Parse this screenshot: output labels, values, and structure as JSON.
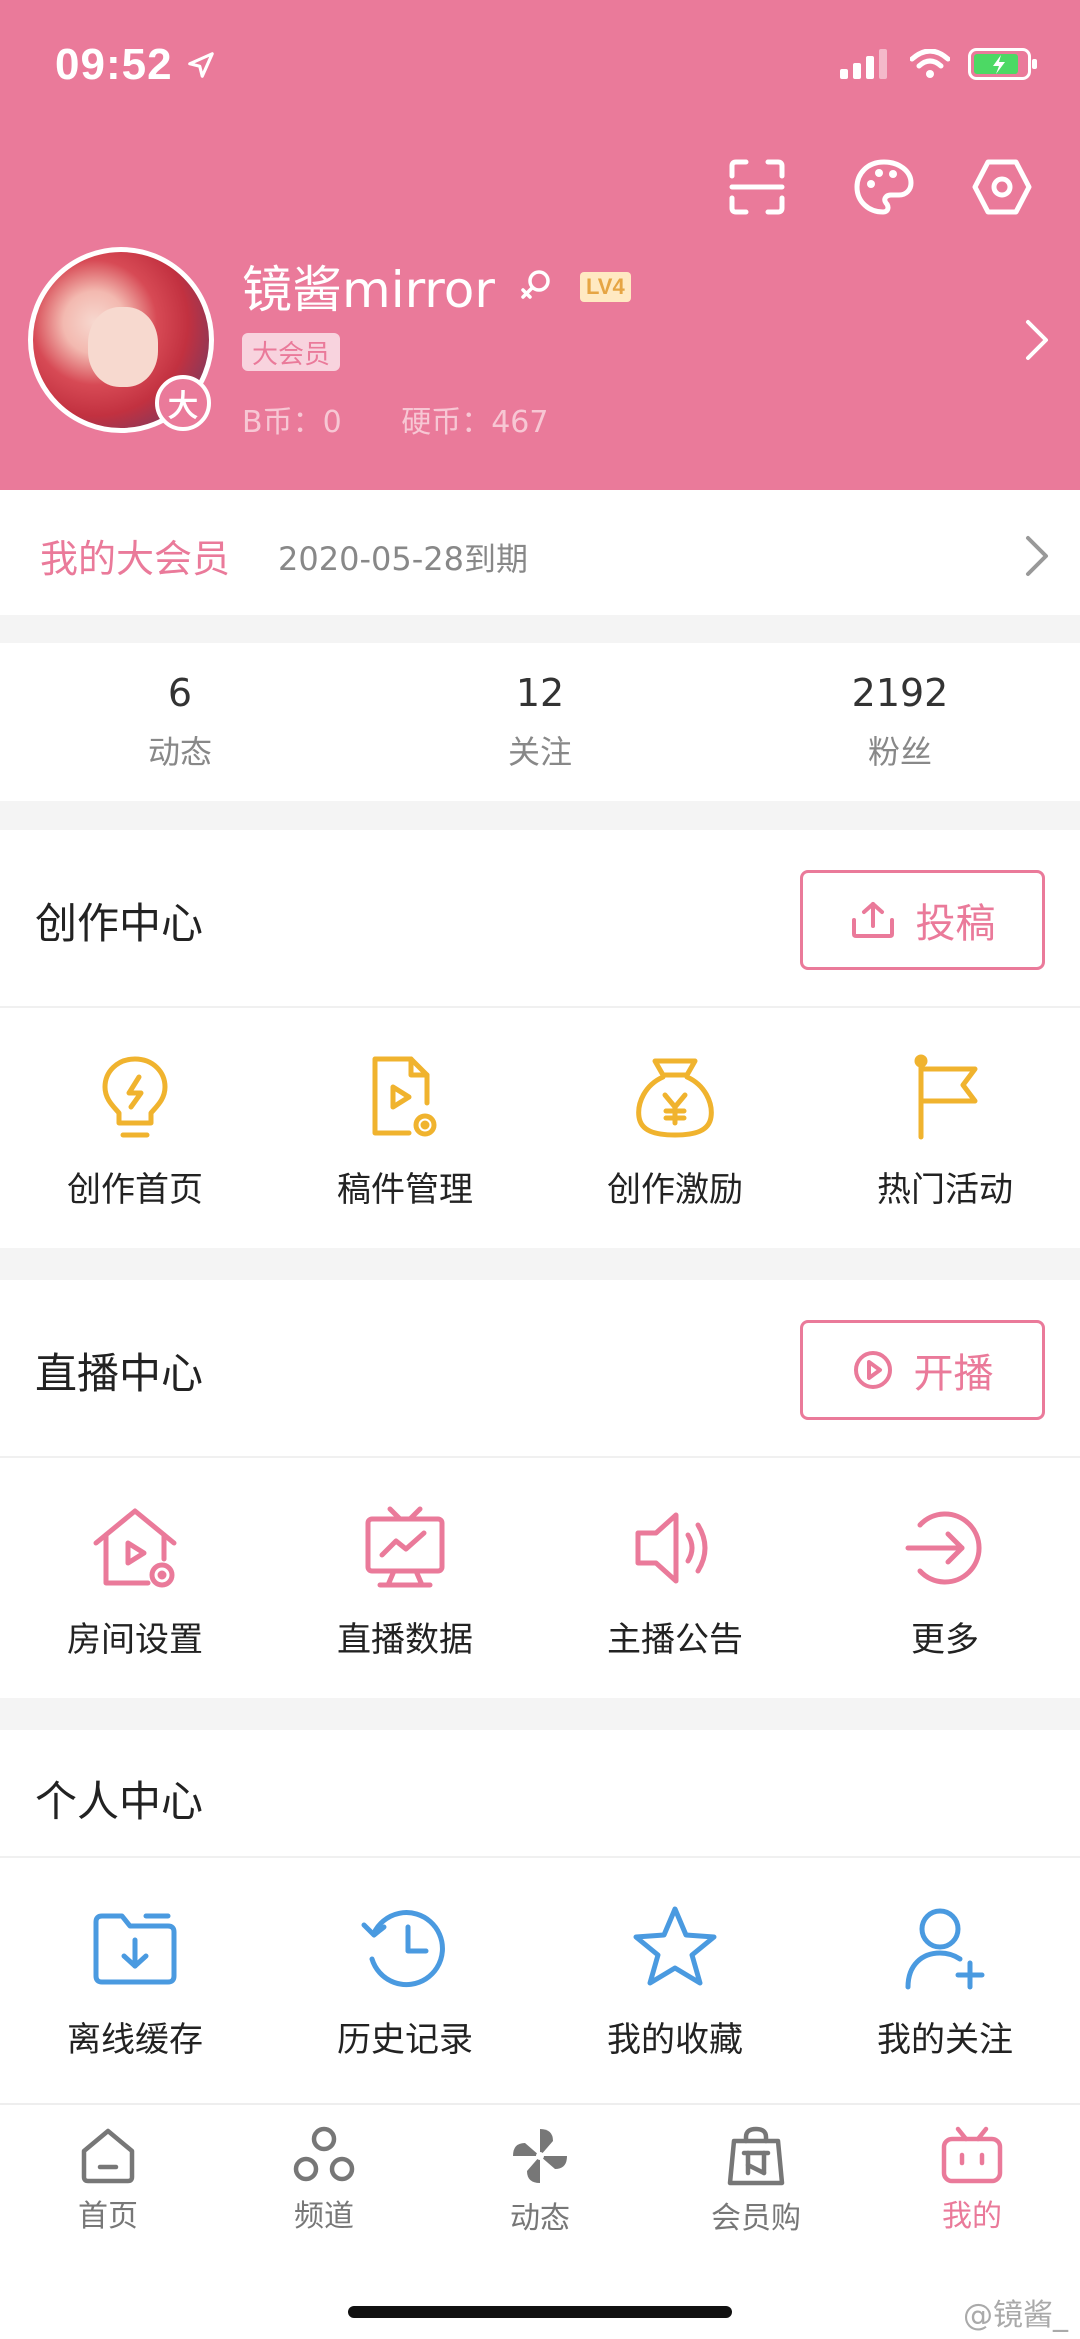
{
  "status": {
    "time": "09:52"
  },
  "header": {
    "user_name": "镜酱mirror",
    "level": "LV4",
    "vip_tag": "大会员",
    "avatar_badge": "大",
    "b_coin": "B币：0",
    "hard_coin": "硬币：467",
    "accent": "#ea7a9a"
  },
  "vip": {
    "title": "我的大会员",
    "expire": "2020-05-28到期"
  },
  "stats": [
    {
      "value": "6",
      "label": "动态"
    },
    {
      "value": "12",
      "label": "关注"
    },
    {
      "value": "2192",
      "label": "粉丝"
    }
  ],
  "creation": {
    "title": "创作中心",
    "button": "投稿",
    "items": [
      {
        "label": "创作首页",
        "icon": "lightbulb-icon"
      },
      {
        "label": "稿件管理",
        "icon": "document-video-icon"
      },
      {
        "label": "创作激励",
        "icon": "money-bag-icon"
      },
      {
        "label": "热门活动",
        "icon": "flag-icon"
      }
    ]
  },
  "live": {
    "title": "直播中心",
    "button": "开播",
    "items": [
      {
        "label": "房间设置",
        "icon": "room-settings-icon"
      },
      {
        "label": "直播数据",
        "icon": "tv-chart-icon"
      },
      {
        "label": "主播公告",
        "icon": "speaker-icon"
      },
      {
        "label": "更多",
        "icon": "arrow-circle-icon"
      }
    ]
  },
  "personal": {
    "title": "个人中心",
    "items": [
      {
        "label": "离线缓存",
        "icon": "download-folder-icon"
      },
      {
        "label": "历史记录",
        "icon": "history-clock-icon"
      },
      {
        "label": "我的收藏",
        "icon": "star-icon"
      },
      {
        "label": "我的关注",
        "icon": "add-user-icon"
      }
    ]
  },
  "tabs": [
    {
      "label": "首页",
      "icon": "home-icon"
    },
    {
      "label": "频道",
      "icon": "channel-icon"
    },
    {
      "label": "动态",
      "icon": "pinwheel-icon"
    },
    {
      "label": "会员购",
      "icon": "shopping-bag-icon"
    },
    {
      "label": "我的",
      "icon": "bilibili-tv-icon",
      "active": true
    }
  ],
  "watermark": "@镜酱_"
}
